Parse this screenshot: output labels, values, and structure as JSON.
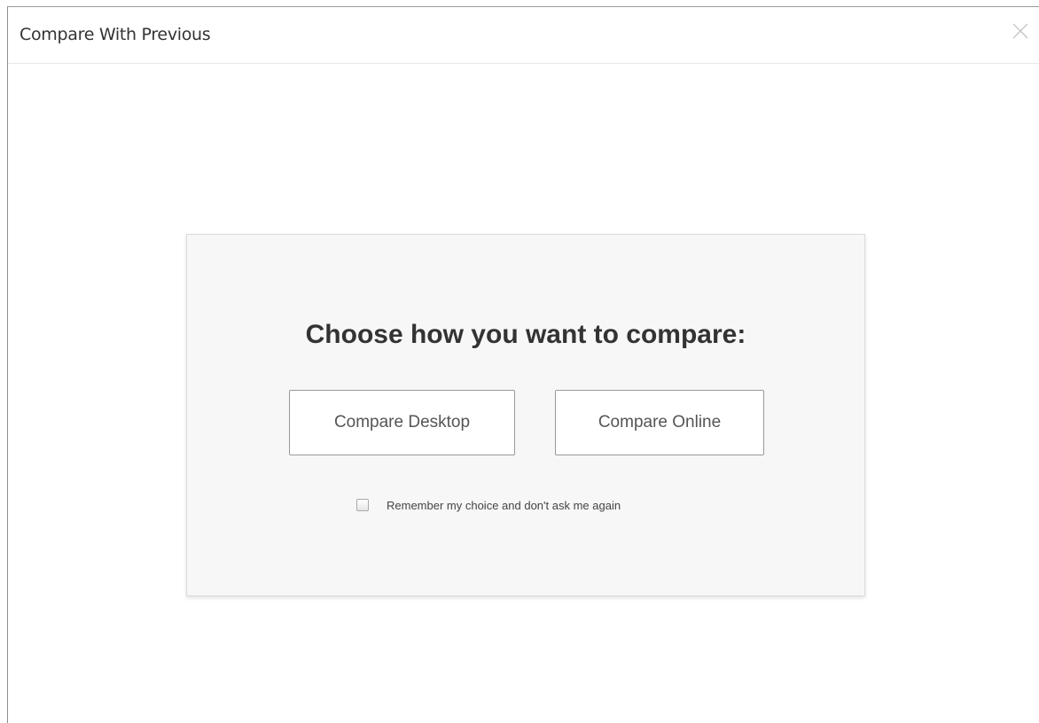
{
  "dialog": {
    "title": "Compare With Previous",
    "close_icon": "close-icon"
  },
  "panel": {
    "heading": "Choose how you want to compare:",
    "buttons": {
      "desktop_label": "Compare Desktop",
      "online_label": "Compare Online"
    },
    "remember": {
      "label": "Remember my choice and don't ask me again",
      "checked": false
    }
  },
  "colors": {
    "panel_background": "#f7f7f7",
    "button_border": "#9a9a9a",
    "heading_text": "#333333"
  }
}
